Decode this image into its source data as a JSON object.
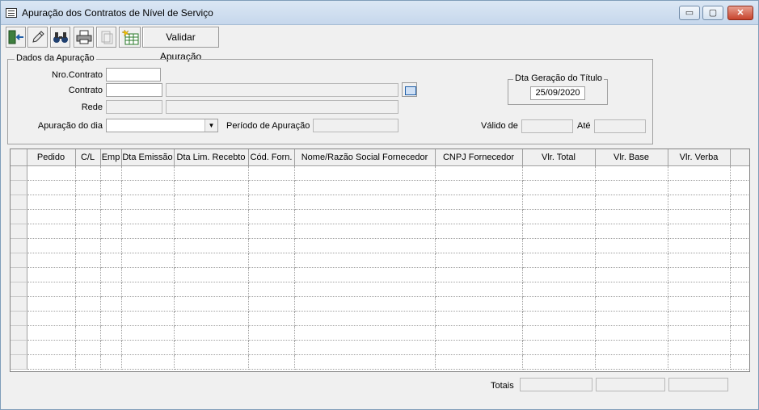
{
  "window": {
    "title": "Apuração dos Contratos de Nível de Serviço",
    "minimize": "▭",
    "maximize": "▢",
    "close": "✕"
  },
  "toolbar": {
    "validate_label": "Validar Apuração"
  },
  "dados": {
    "legend": "Dados da Apuração",
    "nro_contrato_label": "Nro.Contrato",
    "nro_contrato_value": "",
    "contrato_label": "Contrato",
    "contrato_code": "",
    "contrato_desc": "",
    "rede_label": "Rede",
    "rede_code": "",
    "rede_desc": "",
    "apuracao_dia_label": "Apuração do dia",
    "apuracao_dia_value": "",
    "periodo_label": "Período de Apuração",
    "periodo_value": "",
    "dta_geracao_legend": "Dta Geração do Título",
    "dta_geracao_value": "25/09/2020",
    "valido_de_label": "Válido de",
    "valido_de_value": "",
    "ate_label": "Até",
    "ate_value": ""
  },
  "grid": {
    "columns": [
      "Pedido",
      "C/L",
      "Emp",
      "Dta Emissão",
      "Dta Lim. Recebto",
      "Cód. Forn.",
      "Nome/Razão Social Fornecedor",
      "CNPJ Fornecedor",
      "Vlr. Total",
      "Vlr. Base",
      "Vlr. Verba"
    ],
    "rows": []
  },
  "totals": {
    "label": "Totais",
    "vlr_total": "",
    "vlr_base": "",
    "vlr_verba": ""
  }
}
